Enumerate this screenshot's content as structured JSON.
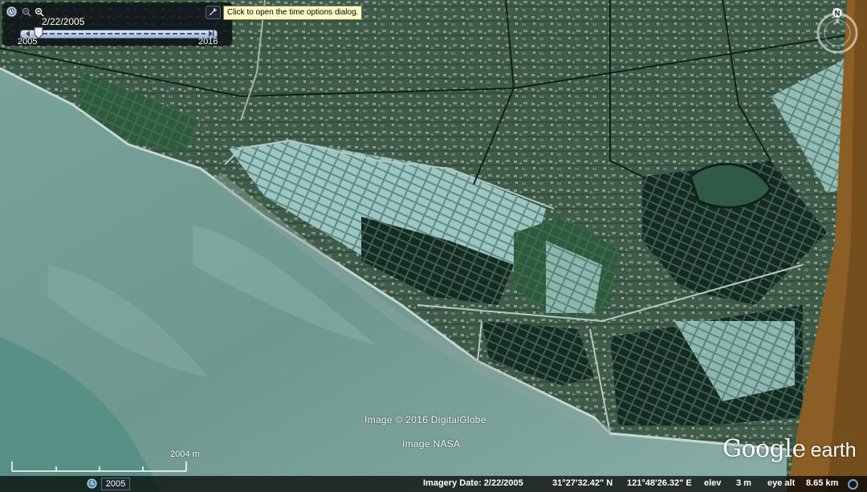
{
  "app": {
    "name": "Google Earth"
  },
  "time_panel": {
    "current_date": "2/22/2005",
    "range_start": "2005",
    "range_end": "2016",
    "slider_fraction": 0.0,
    "tooltip": "Click to open the time options dialog."
  },
  "attributions": {
    "line1": "Image © 2016 DigitalGlobe",
    "line2": "Image NASA"
  },
  "logo": {
    "google": "Google",
    "earth": "earth"
  },
  "compass": {
    "north_label": "N"
  },
  "scale": {
    "label": "2004 m"
  },
  "status": {
    "historical_year": "2005",
    "imagery_date": "Imagery Date: 2/22/2005",
    "latitude": "31°27'32.42\" N",
    "longitude": "121°48'26.32\" E",
    "elev_label": "elev",
    "elev_value": "3 m",
    "eye_alt_label": "eye alt",
    "eye_alt_value": "8.65 km"
  },
  "icons": [
    "clock-icon",
    "zoom-out-icon",
    "zoom-in-icon",
    "wrench-icon",
    "compass-icon",
    "historical-imagery-icon",
    "streaming-indicator-icon"
  ]
}
